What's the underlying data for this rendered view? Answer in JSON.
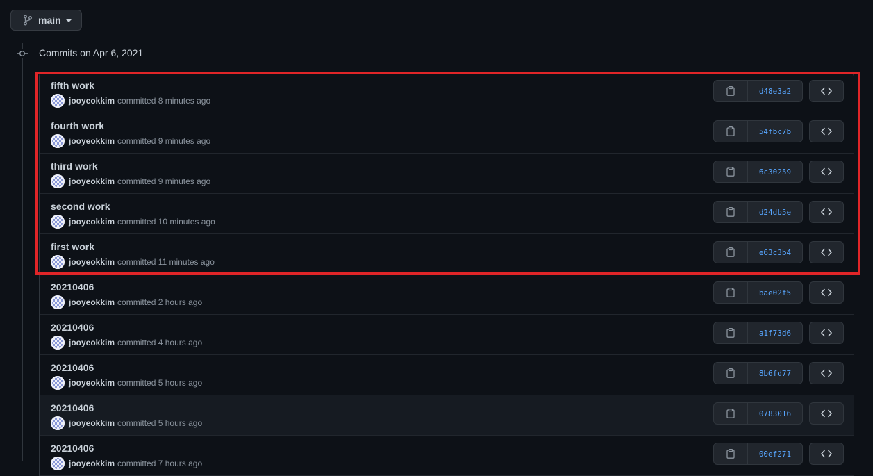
{
  "branch": {
    "name": "main"
  },
  "group": {
    "heading": "Commits on Apr 6, 2021"
  },
  "commit_verb": "committed",
  "commits": [
    {
      "title": "fifth work",
      "author": "jooyeokkim",
      "time": "8 minutes ago",
      "sha": "d48e3a2"
    },
    {
      "title": "fourth work",
      "author": "jooyeokkim",
      "time": "9 minutes ago",
      "sha": "54fbc7b"
    },
    {
      "title": "third work",
      "author": "jooyeokkim",
      "time": "9 minutes ago",
      "sha": "6c30259"
    },
    {
      "title": "second work",
      "author": "jooyeokkim",
      "time": "10 minutes ago",
      "sha": "d24db5e"
    },
    {
      "title": "first work",
      "author": "jooyeokkim",
      "time": "11 minutes ago",
      "sha": "e63c3b4"
    },
    {
      "title": "20210406",
      "author": "jooyeokkim",
      "time": "2 hours ago",
      "sha": "bae02f5"
    },
    {
      "title": "20210406",
      "author": "jooyeokkim",
      "time": "4 hours ago",
      "sha": "a1f73d6"
    },
    {
      "title": "20210406",
      "author": "jooyeokkim",
      "time": "5 hours ago",
      "sha": "8b6fd77"
    },
    {
      "title": "20210406",
      "author": "jooyeokkim",
      "time": "5 hours ago",
      "sha": "0783016"
    },
    {
      "title": "20210406",
      "author": "jooyeokkim",
      "time": "7 hours ago",
      "sha": "00ef271"
    }
  ],
  "colors": {
    "background": "#0d1117",
    "link": "#58a6ff",
    "highlight": "#e02528"
  },
  "icons": {
    "branch": "git-branch-icon",
    "commit": "git-commit-icon",
    "copy": "clipboard-icon",
    "browse": "code-icon"
  }
}
